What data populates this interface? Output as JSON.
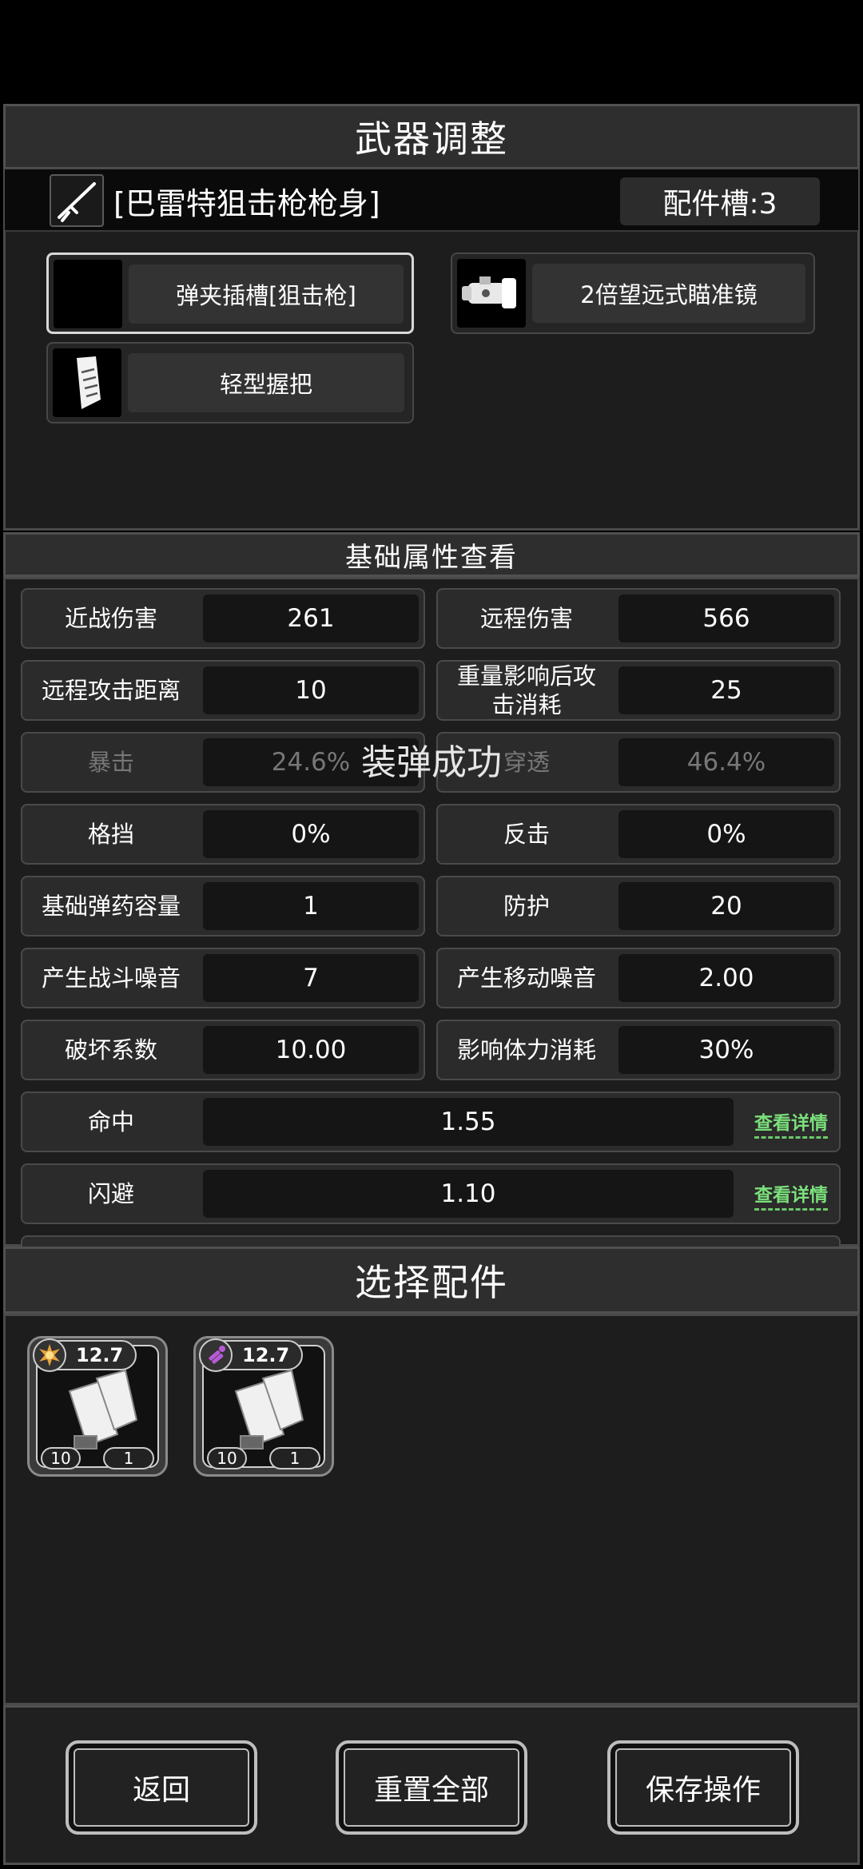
{
  "header": {
    "title": "武器调整"
  },
  "weapon": {
    "name": "[巴雷特狙击枪枪身]",
    "slots": "配件槽:3"
  },
  "attachments": [
    {
      "label": "弹夹插槽[狙击枪]"
    },
    {
      "label": "2倍望远式瞄准镜"
    },
    {
      "label": "轻型握把"
    }
  ],
  "stats_title": "基础属性查看",
  "stats": [
    {
      "name": "近战伤害",
      "value": "261"
    },
    {
      "name": "远程伤害",
      "value": "566"
    },
    {
      "name": "远程攻击距离",
      "value": "10"
    },
    {
      "name": "重量影响后攻击消耗",
      "value": "25"
    },
    {
      "name": "暴击",
      "value": "24.6%"
    },
    {
      "name": "穿透",
      "value": "46.4%"
    },
    {
      "name": "格挡",
      "value": "0%"
    },
    {
      "name": "反击",
      "value": "0%"
    },
    {
      "name": "基础弹药容量",
      "value": "1"
    },
    {
      "name": "防护",
      "value": "20"
    },
    {
      "name": "产生战斗噪音",
      "value": "7"
    },
    {
      "name": "产生移动噪音",
      "value": "2.00"
    },
    {
      "name": "破坏系数",
      "value": "10.00"
    },
    {
      "name": "影响体力消耗",
      "value": "30%"
    },
    {
      "name": "命中",
      "value": "1.55",
      "link": "查看详情"
    },
    {
      "name": "闪避",
      "value": "1.10",
      "link": "查看详情"
    }
  ],
  "toast": "装弹成功",
  "parts_title": "选择配件",
  "parts": [
    {
      "level": "12.7",
      "left": "10",
      "right": "1",
      "badge_color": "#e8a23a"
    },
    {
      "level": "12.7",
      "left": "10",
      "right": "1",
      "badge_color": "#b85ad8"
    }
  ],
  "buttons": {
    "back": "返回",
    "reset": "重置全部",
    "save": "保存操作"
  }
}
